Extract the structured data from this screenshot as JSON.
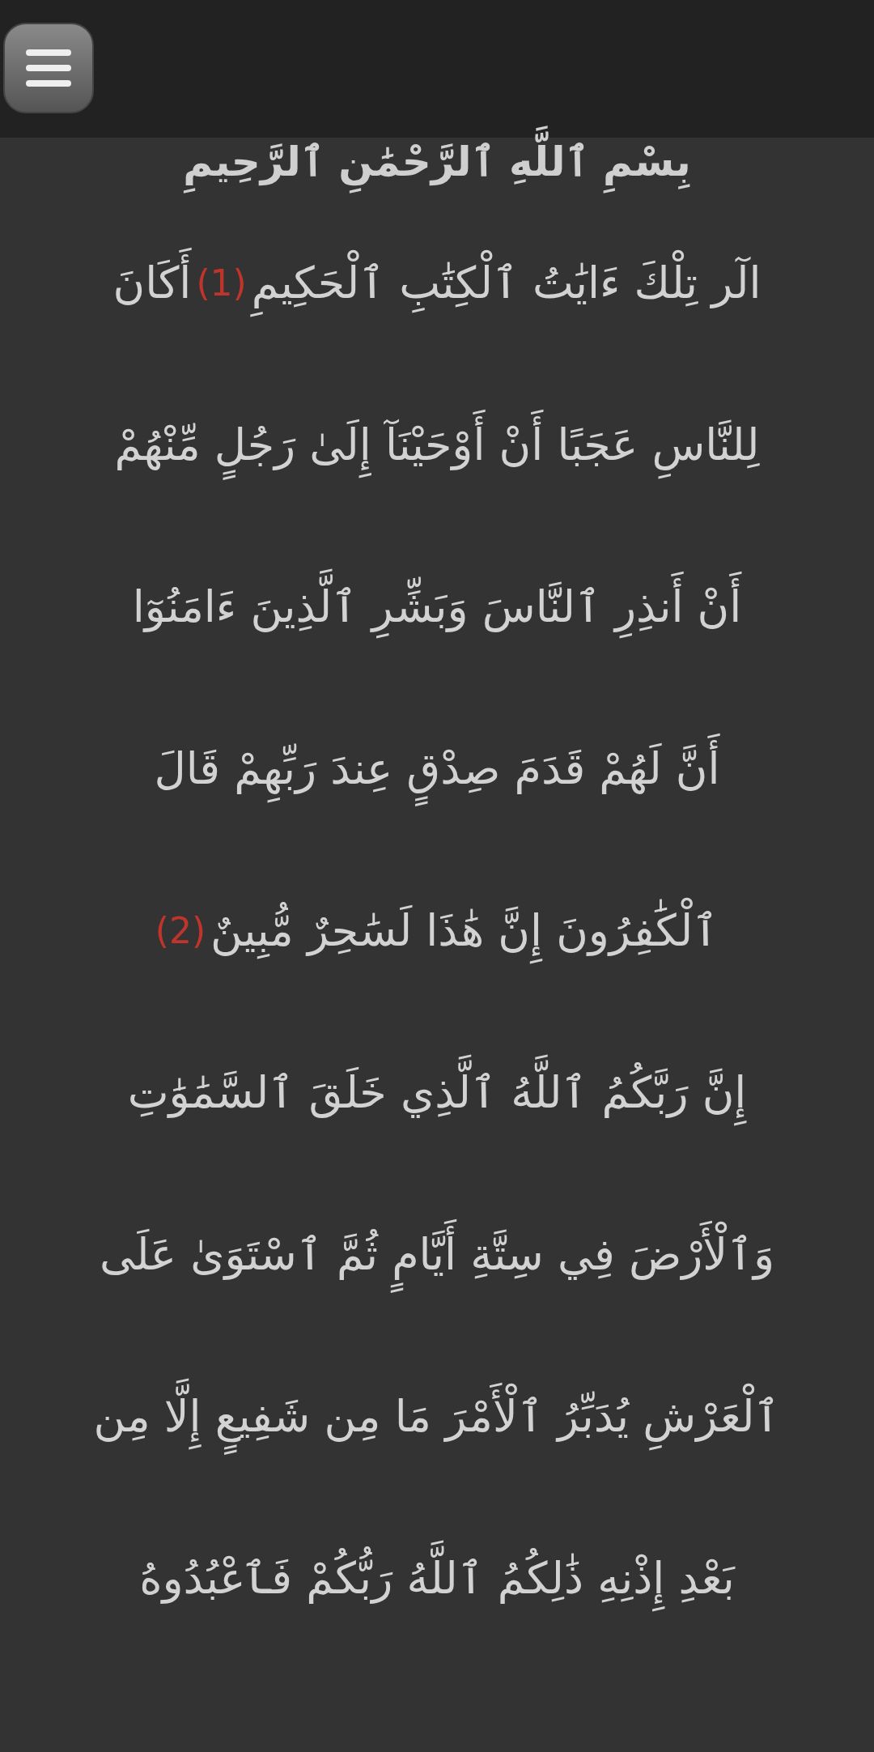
{
  "header": {
    "menu_button": true
  },
  "bismillah": "بِسْمِ ٱللَّهِ ٱلرَّحْمَٰنِ ٱلرَّحِيمِ",
  "lines": [
    [
      {
        "kind": "text",
        "text": "الٓر تِلْكَ ءَايَٰتُ ٱلْكِتَٰبِ ٱلْحَكِيمِ"
      },
      {
        "kind": "ayah_number",
        "text": "(1)"
      },
      {
        "kind": "text",
        "text": "أَكَانَ"
      }
    ],
    [
      {
        "kind": "text",
        "text": "لِلنَّاسِ عَجَبًا أَنْ أَوْحَيْنَآ إِلَىٰ رَجُلٍ مِّنْهُمْ"
      }
    ],
    [
      {
        "kind": "text",
        "text": "أَنْ أَنذِرِ ٱلنَّاسَ وَبَشِّرِ ٱلَّذِينَ ءَامَنُوٓا"
      }
    ],
    [
      {
        "kind": "text",
        "text": "أَنَّ لَهُمْ قَدَمَ صِدْقٍ عِندَ رَبِّهِمْ قَالَ"
      }
    ],
    [
      {
        "kind": "text",
        "text": "ٱلْكَٰفِرُونَ إِنَّ هَٰذَا لَسَٰحِرٌ مُّبِينٌ"
      },
      {
        "kind": "ayah_number",
        "text": "(2)"
      }
    ],
    [
      {
        "kind": "text",
        "text": "إِنَّ رَبَّكُمُ ٱللَّهُ ٱلَّذِي خَلَقَ ٱلسَّمَٰوَٰتِ"
      }
    ],
    [
      {
        "kind": "text",
        "text": "وَٱلْأَرْضَ فِي سِتَّةِ أَيَّامٍ ثُمَّ ٱسْتَوَىٰ عَلَى"
      }
    ],
    [
      {
        "kind": "text",
        "text": "ٱلْعَرْشِ يُدَبِّرُ ٱلْأَمْرَ مَا مِن شَفِيعٍ إِلَّا مِن"
      }
    ],
    [
      {
        "kind": "text",
        "text": "بَعْدِ إِذْنِهِ ذَٰلِكُمُ ٱللَّهُ رَبُّكُمْ فَٱعْبُدُوهُ"
      }
    ]
  ]
}
